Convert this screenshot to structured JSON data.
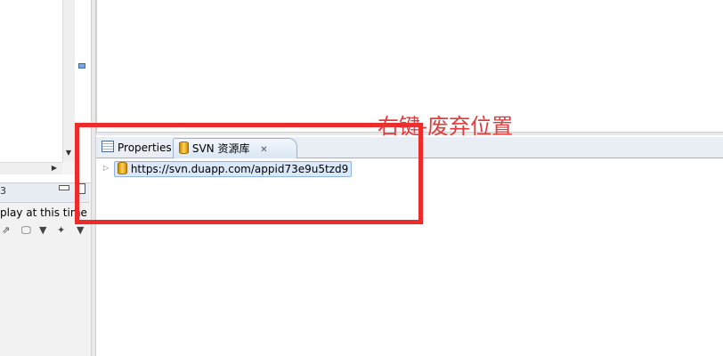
{
  "left_panel": {
    "tab_number": "3",
    "message": "play at this time"
  },
  "bottom_panel": {
    "tabs": [
      {
        "label": "Properties",
        "icon": "properties-icon"
      },
      {
        "label": "SVN 资源库",
        "icon": "svn-repository-icon",
        "active": true
      }
    ],
    "close_glyph": "✕",
    "tree": {
      "items": [
        {
          "label": "https://svn.duapp.com/appid73e9u5tzd9",
          "icon": "repository-db-icon",
          "selected": true
        }
      ]
    }
  },
  "annotation": {
    "text": "右键-废弃位置",
    "color": "#e23a3a"
  },
  "colors": {
    "highlight": "#ee2b2b",
    "selection": "#dbe8f9",
    "tab_active": "#d9e6f4"
  }
}
